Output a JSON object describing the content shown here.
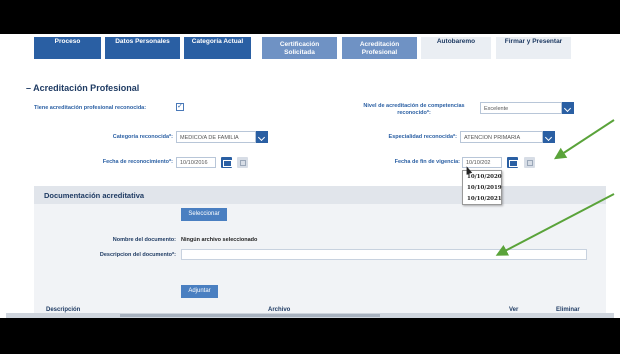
{
  "tabs": [
    {
      "label": "Proceso",
      "style": "blue"
    },
    {
      "label": "Datos Personales",
      "style": "blue"
    },
    {
      "label": "Categoría Actual",
      "style": "blue"
    },
    {
      "label_line1": "Certificación",
      "label_line2": "Solicitada",
      "style": "two"
    },
    {
      "label_line1": "Acreditación",
      "label_line2": "Profesional",
      "style": "two"
    },
    {
      "label": "Autobaremo",
      "style": "grey"
    },
    {
      "label": "Firmar y Presentar",
      "style": "grey"
    }
  ],
  "section": {
    "title": "– Acreditación Profesional"
  },
  "form": {
    "tiene_label": "Tiene acreditación profesional reconocida:",
    "tiene_checked": "✓",
    "nivel_label_line1": "Nivel de acreditación de competencias",
    "nivel_label_line2": "reconocido*:",
    "nivel_value": "Excelente",
    "categoria_label": "Categoría reconocida*:",
    "categoria_value": "MEDICO/A DE FAMILIA",
    "especialidad_label": "Especialidad reconocida*:",
    "especialidad_value": "ATENCION PRIMARIA",
    "fecha_rec_label": "Fecha de reconocimiento*:",
    "fecha_rec_value": "10/10/2016",
    "fecha_fin_label": "Fecha de fin de vigencia:",
    "fecha_fin_value": "10/10/202",
    "fecha_fin_options": [
      "10/10/2020",
      "10/10/2019",
      "10/10/2021"
    ]
  },
  "documents": {
    "title": "Documentación acreditativa",
    "select_button": "Seleccionar",
    "nombre_label": "Nombre del documento:",
    "nombre_value": "Ningún archivo seleccionado",
    "descripcion_label": "Descripcion del documento*:",
    "adjuntar_button": "Adjuntar",
    "columns": {
      "descripcion": "Descripción",
      "archivo": "Archivo",
      "ver": "Ver",
      "eliminar": "Eliminar"
    }
  },
  "colors": {
    "primary": "#2a5fa3",
    "annotation_arrow": "#5aa33a"
  },
  "icons": [
    "checkbox-icon",
    "chevron-down-icon",
    "calendar-icon",
    "clear-icon",
    "mouse-cursor-icon",
    "arrow-annotation-icon"
  ]
}
